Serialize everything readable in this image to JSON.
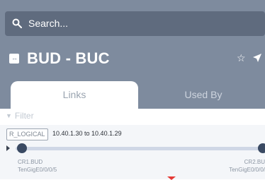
{
  "search": {
    "text": "Search..."
  },
  "object": {
    "title": "BUD - BUC",
    "icon": "link-object-icon"
  },
  "tabs": [
    {
      "label": "Links",
      "active": true
    },
    {
      "label": "Used By",
      "active": false
    }
  ],
  "filter": {
    "label": "Filter"
  },
  "link": {
    "type_badge": "R_LOGICAL",
    "name": "10.40.1.30 to 10.40.1.29",
    "a_end": {
      "device": "CR1.BUD",
      "interface": "TenGigE0/0/0/5"
    },
    "z_end": {
      "device": "CR2.BU",
      "interface": "TenGigE0/0/0/"
    }
  },
  "colors": {
    "header_bg": "#7e8b9e",
    "search_bg": "#5f6b7e",
    "node": "#3a4a63",
    "alarm": "#e53935"
  }
}
